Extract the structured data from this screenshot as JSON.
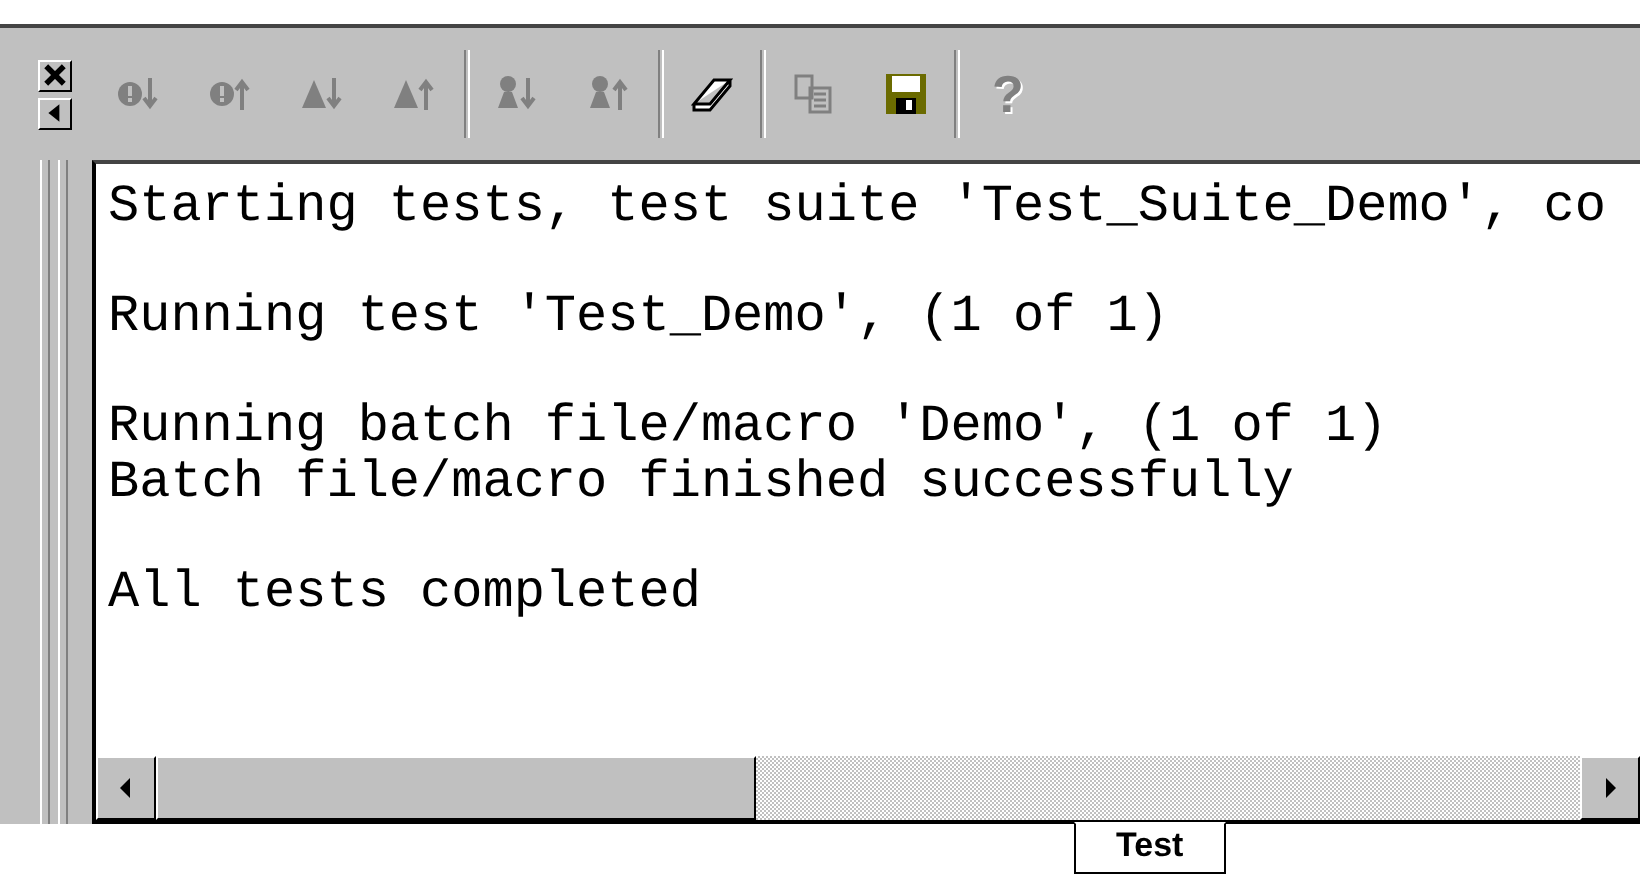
{
  "toolbar": {
    "groups": [
      [
        {
          "disabled": true
        },
        {
          "disabled": true
        },
        {
          "disabled": true
        },
        {
          "disabled": true
        }
      ],
      [
        {
          "disabled": true
        },
        {
          "disabled": true
        }
      ],
      [
        {
          "disabled": false
        }
      ],
      [
        {
          "disabled": true
        },
        {
          "disabled": false
        }
      ],
      [
        {
          "disabled": true,
          "label": "?"
        }
      ]
    ]
  },
  "output": {
    "paragraphs": [
      [
        "Starting tests, test suite 'Test_Suite_Demo', co"
      ],
      [
        "Running test 'Test_Demo', (1 of 1)"
      ],
      [
        "Running batch file/macro 'Demo', (1 of 1)",
        "Batch file/macro finished successfully"
      ],
      [
        "All tests completed"
      ]
    ]
  },
  "tabs": [
    {
      "label": "Test",
      "selected": true
    }
  ]
}
